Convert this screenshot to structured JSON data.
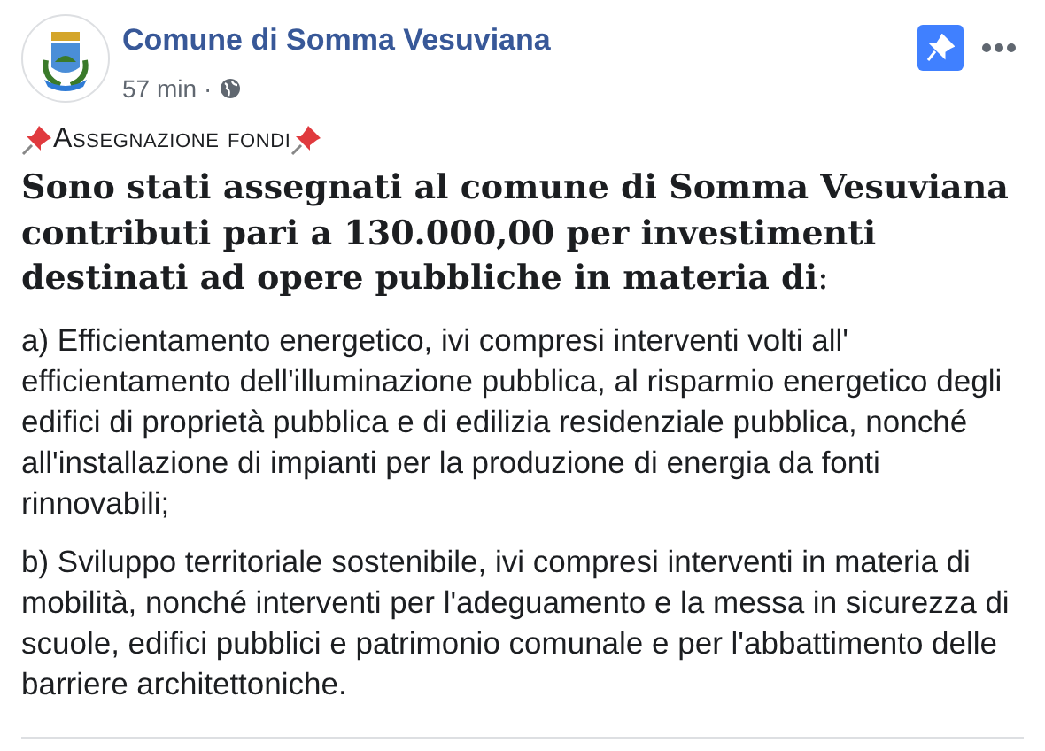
{
  "page": {
    "name": "Comune di Somma Vesuviana",
    "time": "57 min",
    "separator": "·"
  },
  "post": {
    "heading": "Assegnazione fondi",
    "lead": "**Sono stati assegnati al comune di Somma Vesuviana contributi pari a 130.000,00 per investimenti destinati ad opere pubbliche in materia di**:",
    "paragraphs": [
      "a) Efficientamento energetico, ivi compresi interventi volti all' efficientamento dell'illuminazione pubblica, al risparmio energetico degli edifici di proprietà pubblica e di edilizia residenziale pubblica, nonché all'installazione di impianti per la produzione di energia da fonti rinnovabili;",
      "b) Sviluppo territoriale sostenibile, ivi compresi interventi in materia di mobilità, nonché interventi per l'adeguamento e la messa in sicurezza di scuole, edifici pubblici e patrimonio comunale e per l'abbattimento delle barriere architettoniche."
    ]
  },
  "pinned": true
}
